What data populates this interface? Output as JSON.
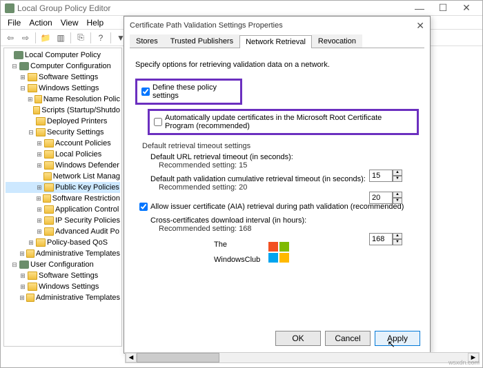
{
  "window": {
    "title": "Local Group Policy Editor"
  },
  "menu": [
    "File",
    "Action",
    "View",
    "Help"
  ],
  "tree": {
    "root": "Local Computer Policy",
    "cc": "Computer Configuration",
    "ss": "Software Settings",
    "ws": "Windows Settings",
    "nrp": "Name Resolution Polic",
    "scr": "Scripts (Startup/Shutdo",
    "dp": "Deployed Printers",
    "sec": "Security Settings",
    "ap": "Account Policies",
    "lp": "Local Policies",
    "wd": "Windows Defender",
    "nlm": "Network List Manag",
    "pkp": "Public Key Policies",
    "sr": "Software Restriction",
    "ac": "Application Control",
    "ips": "IP Security Policies",
    "aap": "Advanced Audit Po",
    "qos": "Policy-based QoS",
    "at": "Administrative Templates",
    "uc": "User Configuration",
    "ucs": "Software Settings",
    "ucw": "Windows Settings",
    "uca": "Administrative Templates"
  },
  "dialog": {
    "title": "Certificate Path Validation Settings Properties",
    "tabs": [
      "Stores",
      "Trusted Publishers",
      "Network Retrieval",
      "Revocation"
    ],
    "active_tab": 2,
    "desc": "Specify options for retrieving validation data on a network.",
    "define": "Define these policy settings",
    "auto": "Automatically update certificates in the Microsoft Root Certificate Program (recommended)",
    "group": "Default retrieval timeout settings",
    "url_label": "Default URL retrieval timeout (in seconds):",
    "url_hint": "Recommended setting: 15",
    "url_val": "15",
    "path_label": "Default path validation cumulative retrieval timeout (in seconds):",
    "path_hint": "Recommended setting: 20",
    "path_val": "20",
    "aia": "Allow issuer certificate (AIA) retrieval during path validation (recommended)",
    "cross_label": "Cross-certificates download interval (in hours):",
    "cross_hint": "Recommended setting: 168",
    "cross_val": "168",
    "ok": "OK",
    "cancel": "Cancel",
    "apply": "Apply"
  },
  "logo": {
    "l1": "The",
    "l2": "WindowsClub"
  },
  "watermark": "wsxdn.com"
}
